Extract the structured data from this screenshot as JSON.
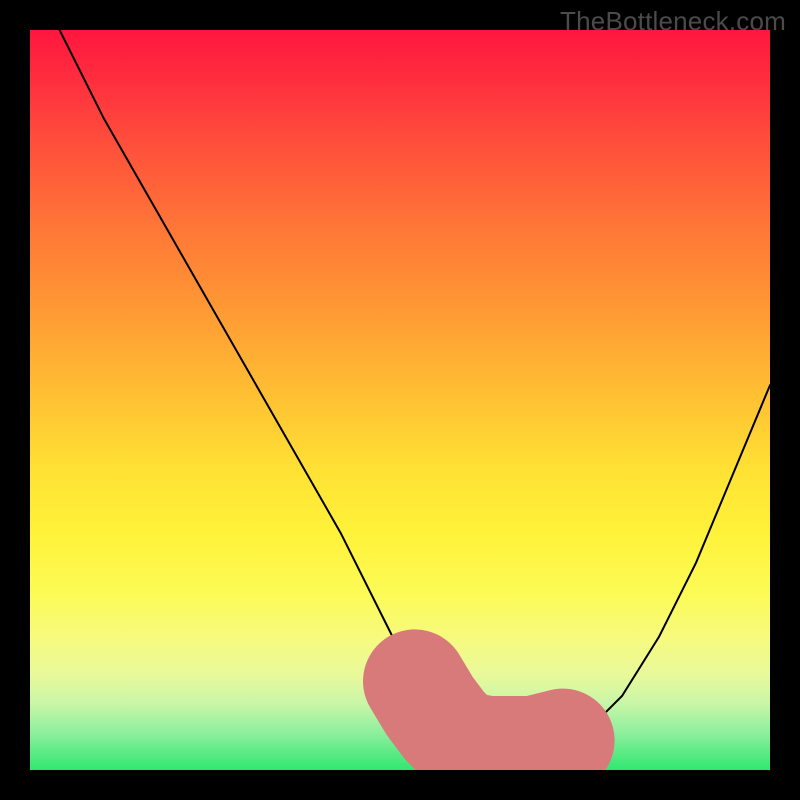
{
  "watermark": "TheBottleneck.com",
  "chart_data": {
    "type": "line",
    "title": "",
    "xlabel": "",
    "ylabel": "",
    "xlim": [
      0,
      100
    ],
    "ylim": [
      0,
      100
    ],
    "grid": false,
    "series": [
      {
        "name": "bottleneck-curve",
        "x": [
          4,
          10,
          18,
          26,
          34,
          42,
          48,
          52,
          55,
          58,
          61,
          64,
          68,
          72,
          76,
          80,
          85,
          90,
          95,
          100
        ],
        "values": [
          100,
          88,
          74,
          60,
          46,
          32,
          20,
          12,
          7,
          4,
          3,
          3,
          3,
          4,
          6,
          10,
          18,
          28,
          40,
          52
        ],
        "stroke": "#000000"
      }
    ],
    "highlight": {
      "name": "valley-highlight",
      "color": "#d97a7a",
      "x_range": [
        52,
        72
      ],
      "y_value": 3,
      "cap_radius": 1.4
    },
    "background_gradient": {
      "top": "#ff163e",
      "mid": "#ffe334",
      "bottom": "#30e771"
    }
  }
}
